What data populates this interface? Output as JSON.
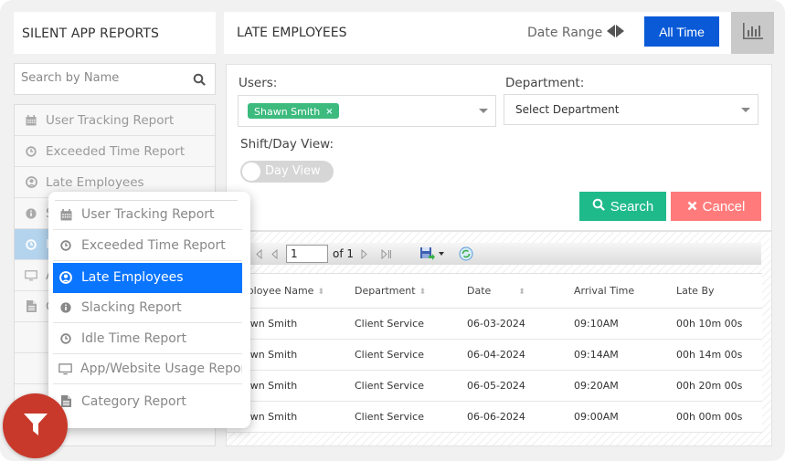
{
  "left_panel": {
    "title": "SILENT APP REPORTS",
    "search_placeholder": "Search by Name",
    "items": [
      {
        "label": "User Tracking Report",
        "icon": "calendar-icon"
      },
      {
        "label": "Exceeded Time Report",
        "icon": "clock-icon"
      },
      {
        "label": "Late Employees",
        "icon": "user-circle-icon"
      },
      {
        "label": "Slacking Report",
        "icon": "info-icon"
      },
      {
        "label": "Idle Time Report",
        "icon": "clock-icon"
      },
      {
        "label": "App/Website Usage Report",
        "icon": "monitor-icon"
      },
      {
        "label": "Category Report",
        "icon": "document-icon"
      }
    ],
    "active_index": 4
  },
  "header": {
    "title": "LATE EMPLOYEES",
    "date_range_label": "Date Range",
    "all_time_label": "All Time",
    "chart_button_icon": "bar-chart-icon"
  },
  "filters": {
    "users_label": "Users:",
    "selected_user": "Shawn Smith",
    "department_label": "Department:",
    "department_placeholder": "Select Department",
    "shift_label": "Shift/Day View:",
    "toggle_label": "Day View",
    "toggle_on": false,
    "search_button": "Search",
    "cancel_button": "Cancel"
  },
  "report": {
    "page_current": "1",
    "page_of": "of 1",
    "columns": [
      "Employee Name",
      "Department",
      "Date",
      "Arrival Time",
      "Late By"
    ],
    "rows": [
      [
        "Shawn Smith",
        "Client Service",
        "06-03-2024",
        "09:10AM",
        "00h 10m 00s"
      ],
      [
        "Shawn Smith",
        "Client Service",
        "06-04-2024",
        "09:14AM",
        "00h 14m 00s"
      ],
      [
        "Shawn Smith",
        "Client Service",
        "06-05-2024",
        "09:20AM",
        "00h 20m 00s"
      ],
      [
        "Shawn Smith",
        "Client Service",
        "06-06-2024",
        "09:00AM",
        "00h 00m 00s"
      ]
    ]
  },
  "popup_menu": {
    "items": [
      {
        "label": "User Tracking Report",
        "icon": "calendar-icon"
      },
      {
        "label": "Exceeded Time Report",
        "icon": "clock-icon"
      },
      {
        "label": "Late Employees",
        "icon": "user-circle-icon"
      },
      {
        "label": "Slacking Report",
        "icon": "info-icon"
      },
      {
        "label": "Idle Time Report",
        "icon": "clock-icon"
      },
      {
        "label": "App/Website Usage Report",
        "icon": "monitor-icon"
      },
      {
        "label": "Category Report",
        "icon": "document-icon"
      }
    ],
    "active_index": 2
  },
  "fab": {
    "icon": "filter-icon"
  },
  "colors": {
    "primary_blue": "#0a5ad8",
    "active_menu_blue": "#0a75ff",
    "search_green": "#1fba8a",
    "cancel_red": "#ff7b7b",
    "chip_green": "#3dba7e",
    "fab_red": "#c8392b"
  }
}
